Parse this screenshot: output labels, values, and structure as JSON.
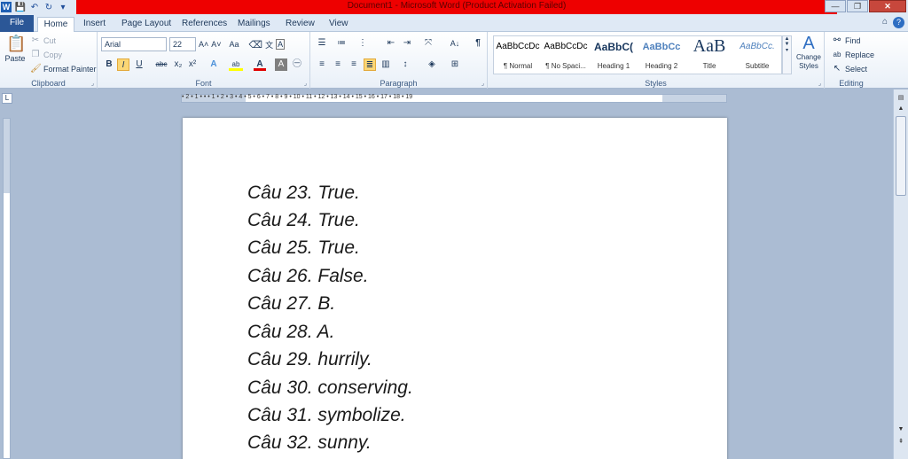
{
  "window": {
    "title": "Document1  -  Microsoft Word (Product Activation Failed)",
    "qat": {
      "logo": "W",
      "save": "💾",
      "undo": "↶",
      "redo": "↻",
      "more": "▾"
    },
    "controls": {
      "minimize": "—",
      "maximize": "❐",
      "close": "✕"
    },
    "colors": {
      "title_bar": "#ee0000",
      "file_tab": "#2b5797"
    }
  },
  "tabs": {
    "file": "File",
    "home": "Home",
    "insert": "Insert",
    "page_layout": "Page Layout",
    "references": "References",
    "mailings": "Mailings",
    "review": "Review",
    "view": "View",
    "collapse_icon": "⌂",
    "help_icon": "?"
  },
  "clipboard": {
    "paste": "Paste",
    "cut": "Cut",
    "copy": "Copy",
    "format_painter": "Format Painter",
    "label": "Clipboard"
  },
  "font": {
    "name": "Arial",
    "size": "22",
    "grow": "A˄",
    "shrink": "A˅",
    "change_case": "Aa",
    "clear": "A",
    "bold": "B",
    "italic": "I",
    "underline": "U",
    "strike": "abc",
    "subscript": "x₂",
    "superscript": "x²",
    "text_effects": "A",
    "highlight": "ab",
    "font_color": "A",
    "label": "Font"
  },
  "paragraph": {
    "label": "Paragraph",
    "pilcrow": "¶",
    "sort": "A↓"
  },
  "styles": {
    "items": [
      {
        "preview": "AaBbCcDc",
        "name": "¶ Normal"
      },
      {
        "preview": "AaBbCcDc",
        "name": "¶ No Spaci..."
      },
      {
        "preview": "AaBbC(",
        "name": "Heading 1"
      },
      {
        "preview": "AaBbCc",
        "name": "Heading 2"
      },
      {
        "preview": "AaB",
        "name": "Title"
      },
      {
        "preview": "AaBbCc.",
        "name": "Subtitle"
      }
    ],
    "change_styles": "Change Styles",
    "label": "Styles"
  },
  "editing": {
    "find": "Find",
    "replace": "Replace",
    "select": "Select",
    "label": "Editing"
  },
  "ruler": {
    "numbers": "• 2 • 1 • • • 1 • 2 • 3 • 4 • 5 • 6 • 7 • 8 • 9 • 10 • 11 • 12 • 13 • 14 • 15 • 16 • 17 • 18 • 19"
  },
  "document": {
    "lines": [
      "Câu 23. True.",
      "Câu 24. True.",
      "Câu 25. True.",
      "Câu 26. False.",
      "Câu 27. B.",
      "Câu 28. A.",
      "Câu 29. hurrily.",
      "Câu 30. conserving.",
      "Câu 31. symbolize.",
      "Câu 32. sunny."
    ]
  }
}
